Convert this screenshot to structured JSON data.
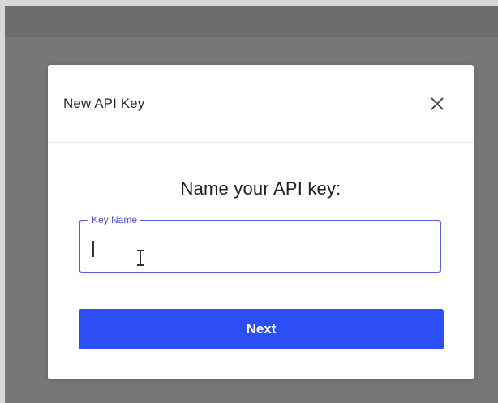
{
  "dialog": {
    "title": "New API Key",
    "close_icon": "close-icon",
    "prompt": "Name your API key:",
    "key_name_field": {
      "label": "Key Name",
      "value": "",
      "placeholder": ""
    },
    "next_label": "Next"
  },
  "colors": {
    "accent": "#2e4ef5",
    "field_border": "#5a5fe0",
    "overlay": "#777779"
  }
}
